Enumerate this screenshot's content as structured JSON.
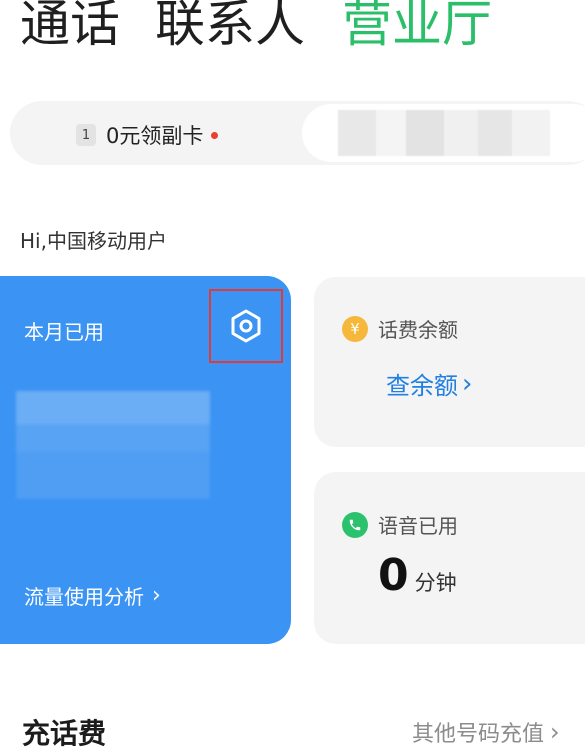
{
  "tabs": {
    "calls": "通话",
    "contacts": "联系人",
    "store": "营业厅"
  },
  "sim": {
    "badge": "1",
    "label": "0元领副卡"
  },
  "greeting": "Hi,中国移动用户",
  "usage_card": {
    "title": "本月已用",
    "link_label": "流量使用分析",
    "chevron": "›"
  },
  "balance_card": {
    "label": "话费余额",
    "icon": "yen-icon",
    "icon_glyph": "¥",
    "link_label": "查余额",
    "chevron": "›"
  },
  "voice_card": {
    "label": "语音已用",
    "icon": "phone-icon",
    "value": "0",
    "unit": "分钟"
  },
  "recharge": {
    "title": "充话费",
    "other_label": "其他号码充值",
    "chevron": "›"
  },
  "colors": {
    "accent_green": "#2cbf6a",
    "card_blue": "#3b93f3",
    "link_blue": "#1f7fe3",
    "highlight_red": "#e03a3a"
  }
}
